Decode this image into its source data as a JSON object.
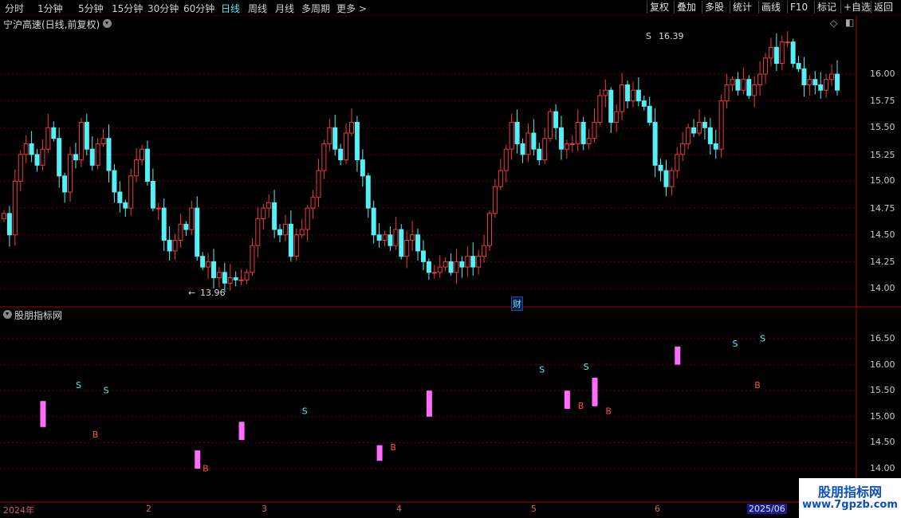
{
  "toolbar": {
    "periods": [
      "分时",
      "1分钟",
      "5分钟",
      "15分钟",
      "30分钟",
      "60分钟",
      "日线",
      "周线",
      "月线",
      "多周期",
      "更多 >"
    ],
    "active_period": "日线",
    "tools": [
      "复权",
      "叠加",
      "多股",
      "统计",
      "画线",
      "F10",
      "标记",
      "+自选",
      "返回"
    ]
  },
  "main_panel": {
    "title": "宁沪高速(日线,前复权)",
    "high_label": "16.39",
    "low_label": "13.96",
    "finance_marker": "财",
    "high_marker": "S",
    "low_arrow": "←",
    "price_ticks": [
      "16.00",
      "15.75",
      "15.50",
      "15.25",
      "15.00",
      "14.75",
      "14.50",
      "14.25",
      "14.00"
    ]
  },
  "indicator_panel": {
    "title": "股朋指标网",
    "value_ticks": [
      "16.50",
      "16.00",
      "15.50",
      "15.00",
      "14.50",
      "14.00"
    ]
  },
  "date_axis": {
    "labels": [
      "2024年",
      "2",
      "3",
      "4",
      "5",
      "6",
      "2025/06"
    ]
  },
  "watermark": {
    "title": "股朋指标网",
    "url": "www.7gpzb.com"
  },
  "colors": {
    "up": "#ee3b3b",
    "down": "#54f0f5",
    "bar_pink": "#ff6cff",
    "buy_text": "#ff4d4d",
    "sell_text": "#54f0f5",
    "grid": "#6b0000",
    "active": "#5fe8ef"
  },
  "chart_data": {
    "type": "candlestick",
    "series_count": 148,
    "price_axis_ticks": [
      16.0,
      15.75,
      15.5,
      15.25,
      15.0,
      14.75,
      14.5,
      14.25,
      14.0
    ],
    "ylim": [
      13.9,
      16.55
    ],
    "high": 16.39,
    "low": 13.96,
    "closes": [
      14.7,
      14.5,
      15.0,
      15.25,
      15.35,
      15.25,
      15.15,
      15.3,
      15.5,
      15.4,
      15.05,
      14.9,
      15.25,
      15.2,
      15.55,
      15.3,
      15.15,
      15.35,
      15.4,
      15.1,
      14.9,
      14.8,
      14.75,
      15.05,
      15.2,
      15.3,
      15.0,
      14.75,
      14.75,
      14.45,
      14.35,
      14.45,
      14.6,
      14.55,
      14.75,
      14.3,
      14.2,
      14.25,
      14.1,
      14.15,
      14.05,
      14.1,
      14.08,
      14.08,
      14.15,
      14.4,
      14.65,
      14.75,
      14.8,
      14.55,
      14.5,
      14.6,
      14.3,
      14.5,
      14.55,
      14.75,
      14.85,
      15.1,
      15.35,
      15.5,
      15.3,
      15.2,
      15.45,
      15.55,
      15.2,
      15.05,
      14.75,
      14.5,
      14.45,
      14.5,
      14.4,
      14.55,
      14.3,
      14.45,
      14.5,
      14.35,
      14.25,
      14.15,
      14.15,
      14.2,
      14.25,
      14.15,
      14.25,
      14.2,
      14.3,
      14.2,
      14.3,
      14.4,
      14.7,
      14.95,
      15.1,
      15.3,
      15.55,
      15.35,
      15.25,
      15.45,
      15.3,
      15.2,
      15.4,
      15.65,
      15.5,
      15.3,
      15.35,
      15.35,
      15.55,
      15.35,
      15.4,
      15.55,
      15.8,
      15.85,
      15.55,
      15.65,
      15.9,
      15.75,
      15.85,
      15.75,
      15.7,
      15.55,
      15.15,
      15.1,
      14.95,
      15.1,
      15.25,
      15.35,
      15.5,
      15.45,
      15.55,
      15.5,
      15.35,
      15.3,
      15.75,
      15.9,
      15.95,
      15.85,
      15.95,
      15.8,
      15.9,
      16.0,
      16.15,
      16.25,
      16.1,
      16.3,
      16.3,
      16.1,
      16.05,
      15.9,
      15.95,
      15.9,
      15.85,
      15.95,
      16.0,
      15.85
    ],
    "indicator_axis_ticks": [
      16.5,
      16.0,
      15.5,
      15.0,
      14.5,
      14.0
    ],
    "signal_bars": [
      {
        "date_index": 7,
        "low": 14.8,
        "high": 15.3
      },
      {
        "date_index": 35,
        "low": 14.0,
        "high": 14.35
      },
      {
        "date_index": 43,
        "low": 14.55,
        "high": 14.9
      },
      {
        "date_index": 68,
        "low": 14.15,
        "high": 14.45
      },
      {
        "date_index": 77,
        "low": 15.0,
        "high": 15.5
      },
      {
        "date_index": 102,
        "low": 15.15,
        "high": 15.5
      },
      {
        "date_index": 107,
        "low": 15.2,
        "high": 15.75
      },
      {
        "date_index": 122,
        "low": 16.0,
        "high": 16.35
      }
    ],
    "signals": [
      {
        "type": "S",
        "date_index": 13,
        "value": 15.55
      },
      {
        "type": "S",
        "date_index": 18,
        "value": 15.45
      },
      {
        "type": "B",
        "date_index": 16,
        "value": 14.6
      },
      {
        "type": "B",
        "date_index": 36,
        "value": 13.95
      },
      {
        "type": "S",
        "date_index": 54,
        "value": 15.05
      },
      {
        "type": "B",
        "date_index": 70,
        "value": 14.35
      },
      {
        "type": "S",
        "date_index": 97,
        "value": 15.85
      },
      {
        "type": "B",
        "date_index": 104,
        "value": 15.15
      },
      {
        "type": "S",
        "date_index": 105,
        "value": 15.9
      },
      {
        "type": "B",
        "date_index": 109,
        "value": 15.05
      },
      {
        "type": "S",
        "date_index": 132,
        "value": 16.35
      },
      {
        "type": "S",
        "date_index": 137,
        "value": 16.45
      },
      {
        "type": "B",
        "date_index": 136,
        "value": 15.55
      }
    ]
  }
}
